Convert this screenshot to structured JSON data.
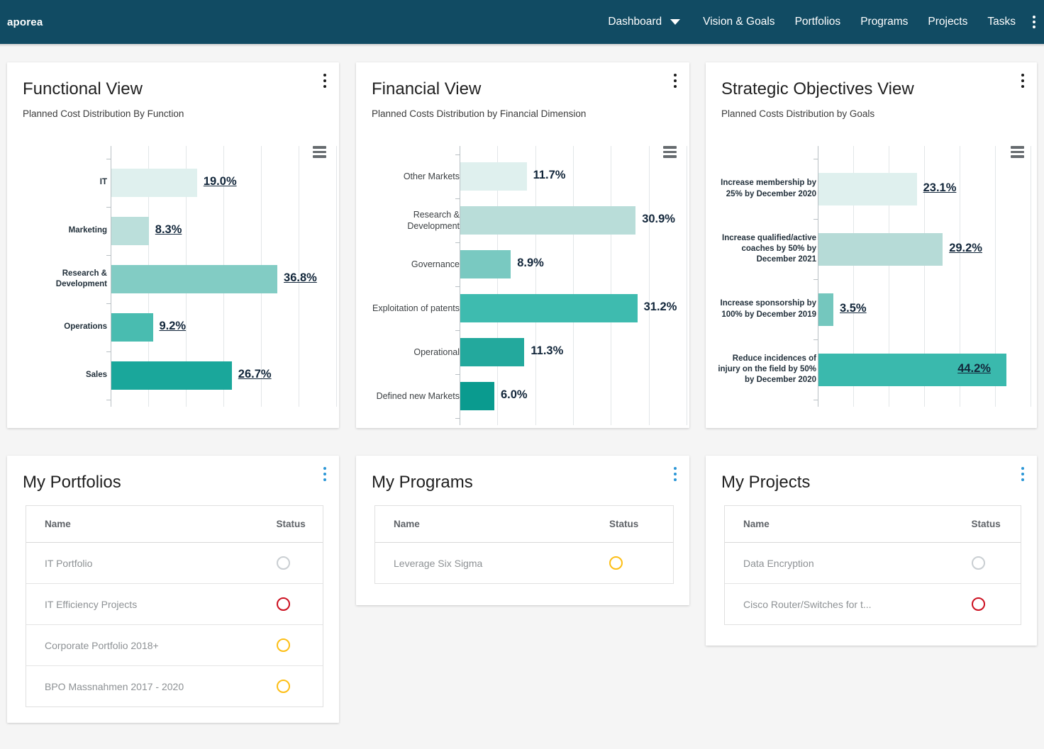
{
  "topbar": {
    "brand": "aporea",
    "nav": [
      {
        "label": "Dashboard",
        "has_caret": true
      },
      {
        "label": "Vision & Goals",
        "has_caret": false
      },
      {
        "label": "Portfolios",
        "has_caret": false
      },
      {
        "label": "Programs",
        "has_caret": false
      },
      {
        "label": "Projects",
        "has_caret": false
      },
      {
        "label": "Tasks",
        "has_caret": false
      }
    ],
    "overflow_icon": "kebab-menu-icon",
    "background": "#114b63"
  },
  "cards": {
    "functional": {
      "title": "Functional View",
      "subtitle": "Planned Cost Distribution By Function"
    },
    "financial": {
      "title": "Financial View",
      "subtitle": "Planned Costs Distribution by Financial Dimension"
    },
    "strategic": {
      "title": "Strategic Objectives View",
      "subtitle": "Planned Costs Distribution by Goals"
    },
    "portfolios": {
      "title": "My Portfolios"
    },
    "programs": {
      "title": "My Programs"
    },
    "projects": {
      "title": "My Projects"
    }
  },
  "chart_data": [
    {
      "id": "functional",
      "type": "bar",
      "orientation": "horizontal",
      "title": "Functional View",
      "subtitle": "Planned Cost Distribution By Function",
      "xlabel": "",
      "ylabel": "",
      "xlim": [
        0,
        50
      ],
      "grid": true,
      "legend": false,
      "categories": [
        "IT",
        "Marketing",
        "Research & Development",
        "Operations",
        "Sales"
      ],
      "values": [
        19.0,
        8.3,
        36.8,
        9.2,
        26.7
      ],
      "labels": [
        "19.0%",
        "8.3%",
        "36.8%",
        "9.2%",
        "26.7%"
      ],
      "colors": [
        "#dff0ee",
        "#bbdfdb",
        "#82ccc4",
        "#49bcb0",
        "#1aa79b"
      ]
    },
    {
      "id": "financial",
      "type": "bar",
      "orientation": "horizontal",
      "title": "Financial View",
      "subtitle": "Planned Costs Distribution by Financial Dimension",
      "xlabel": "",
      "ylabel": "",
      "xlim": [
        0,
        40
      ],
      "grid": true,
      "legend": false,
      "categories": [
        "Other Markets",
        "Research & Development",
        "Governance",
        "Exploitation of patents",
        "Operational",
        "Defined new Markets"
      ],
      "values": [
        11.7,
        30.9,
        8.9,
        31.2,
        11.3,
        6.0
      ],
      "labels": [
        "11.7%",
        "30.9%",
        "8.9%",
        "31.2%",
        "11.3%",
        "6.0%"
      ],
      "colors": [
        "#dff0ee",
        "#b9ddd9",
        "#79c9c1",
        "#3ebbaf",
        "#23a99d",
        "#0a9b8f"
      ]
    },
    {
      "id": "strategic",
      "type": "bar",
      "orientation": "horizontal",
      "title": "Strategic Objectives View",
      "subtitle": "Planned Costs Distribution by Goals",
      "xlabel": "",
      "ylabel": "",
      "xlim": [
        0,
        50
      ],
      "grid": true,
      "legend": false,
      "categories": [
        "Increase membership by 25% by December 2020",
        "Increase qualified/active coaches by 50% by December 2021",
        "Increase sponsorship by 100% by December 2019",
        "Reduce incidences of injury on the field by 50% by December 2020"
      ],
      "values": [
        23.1,
        29.2,
        3.5,
        44.2
      ],
      "labels": [
        "23.1%",
        "29.2%",
        "3.5%",
        "44.2%"
      ],
      "colors": [
        "#dff0ee",
        "#b6dbd7",
        "#74c7be",
        "#3ab9ad"
      ]
    }
  ],
  "tables": {
    "portfolios": {
      "columns": [
        "Name",
        "Status"
      ],
      "rows": [
        {
          "name": "IT Portfolio",
          "status": "grey"
        },
        {
          "name": "IT Efficiency Projects",
          "status": "red"
        },
        {
          "name": "Corporate Portfolio 2018+",
          "status": "yellow"
        },
        {
          "name": "BPO Massnahmen 2017 - 2020",
          "status": "yellow"
        }
      ]
    },
    "programs": {
      "columns": [
        "Name",
        "Status"
      ],
      "rows": [
        {
          "name": "Leverage Six Sigma",
          "status": "yellow"
        }
      ]
    },
    "projects": {
      "columns": [
        "Name",
        "Status"
      ],
      "rows": [
        {
          "name": "Data Encryption",
          "status": "grey"
        },
        {
          "name": "Cisco Router/Switches for t...",
          "status": "red"
        }
      ]
    }
  },
  "status_colors": {
    "grey": "#c9ced2",
    "red": "#cc0f1f",
    "yellow": "#fdbe14"
  }
}
